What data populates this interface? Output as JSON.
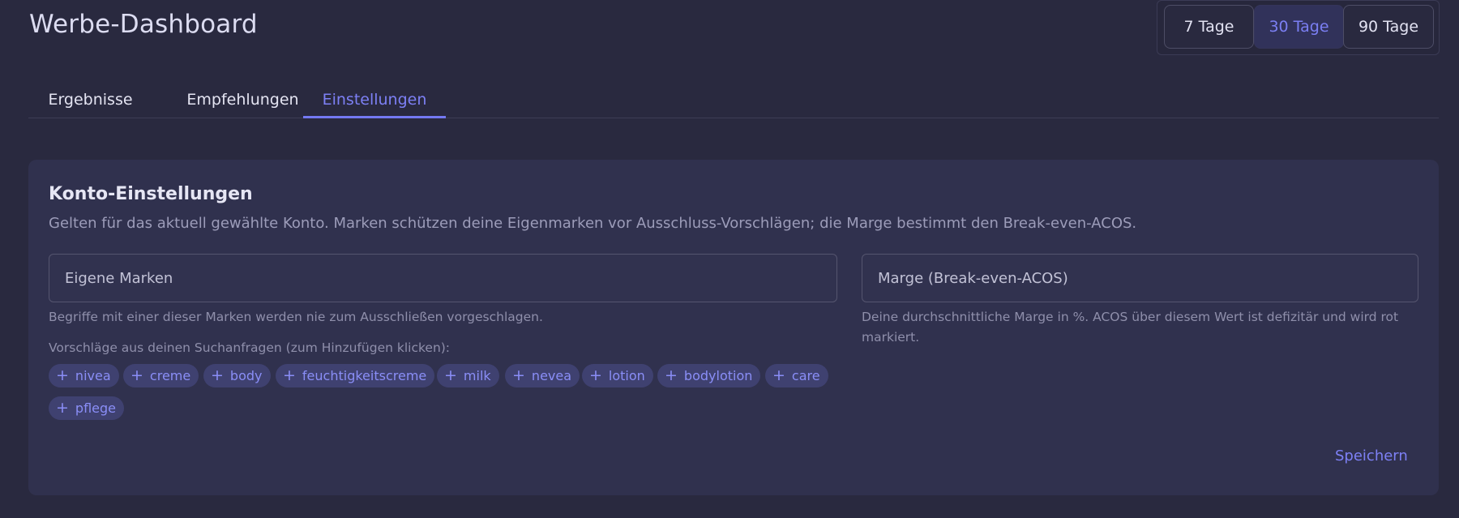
{
  "header": {
    "title": "Werbe-Dashboard"
  },
  "range": {
    "options": [
      "7 Tage",
      "30 Tage",
      "90 Tage"
    ],
    "selected": "30 Tage"
  },
  "tabs": [
    {
      "label": "Ergebnisse"
    },
    {
      "label": "Empfehlungen"
    },
    {
      "label": "Einstellungen",
      "active": true
    }
  ],
  "settings": {
    "title": "Konto-Einstellungen",
    "description": "Gelten für das aktuell gewählte Konto. Marken schützen deine Eigenmarken vor Ausschluss-Vorschlägen; die Marge bestimmt den Break-even-ACOS.",
    "brands": {
      "placeholder": "Eigene Marken",
      "value": "",
      "help": "Begriffe mit einer dieser Marken werden nie zum Ausschließen vorgeschlagen."
    },
    "margin": {
      "placeholder": "Marge (Break-even-ACOS)",
      "value": "",
      "help": "Deine durchschnittliche Marge in %. ACOS über diesem Wert ist defizitär und wird rot markiert."
    },
    "suggestions_label": "Vorschläge aus deinen Suchanfragen (zum Hinzufügen klicken):",
    "suggestions": [
      "nivea",
      "creme",
      "body",
      "feuchtigkeitscreme",
      "milk",
      "nevea",
      "lotion",
      "bodylotion",
      "care",
      "pflege"
    ],
    "save_label": "Speichern"
  },
  "colors": {
    "accent": "#7d80f5",
    "background": "#29293f",
    "card": "#30314e",
    "chip": "#3f4170"
  }
}
